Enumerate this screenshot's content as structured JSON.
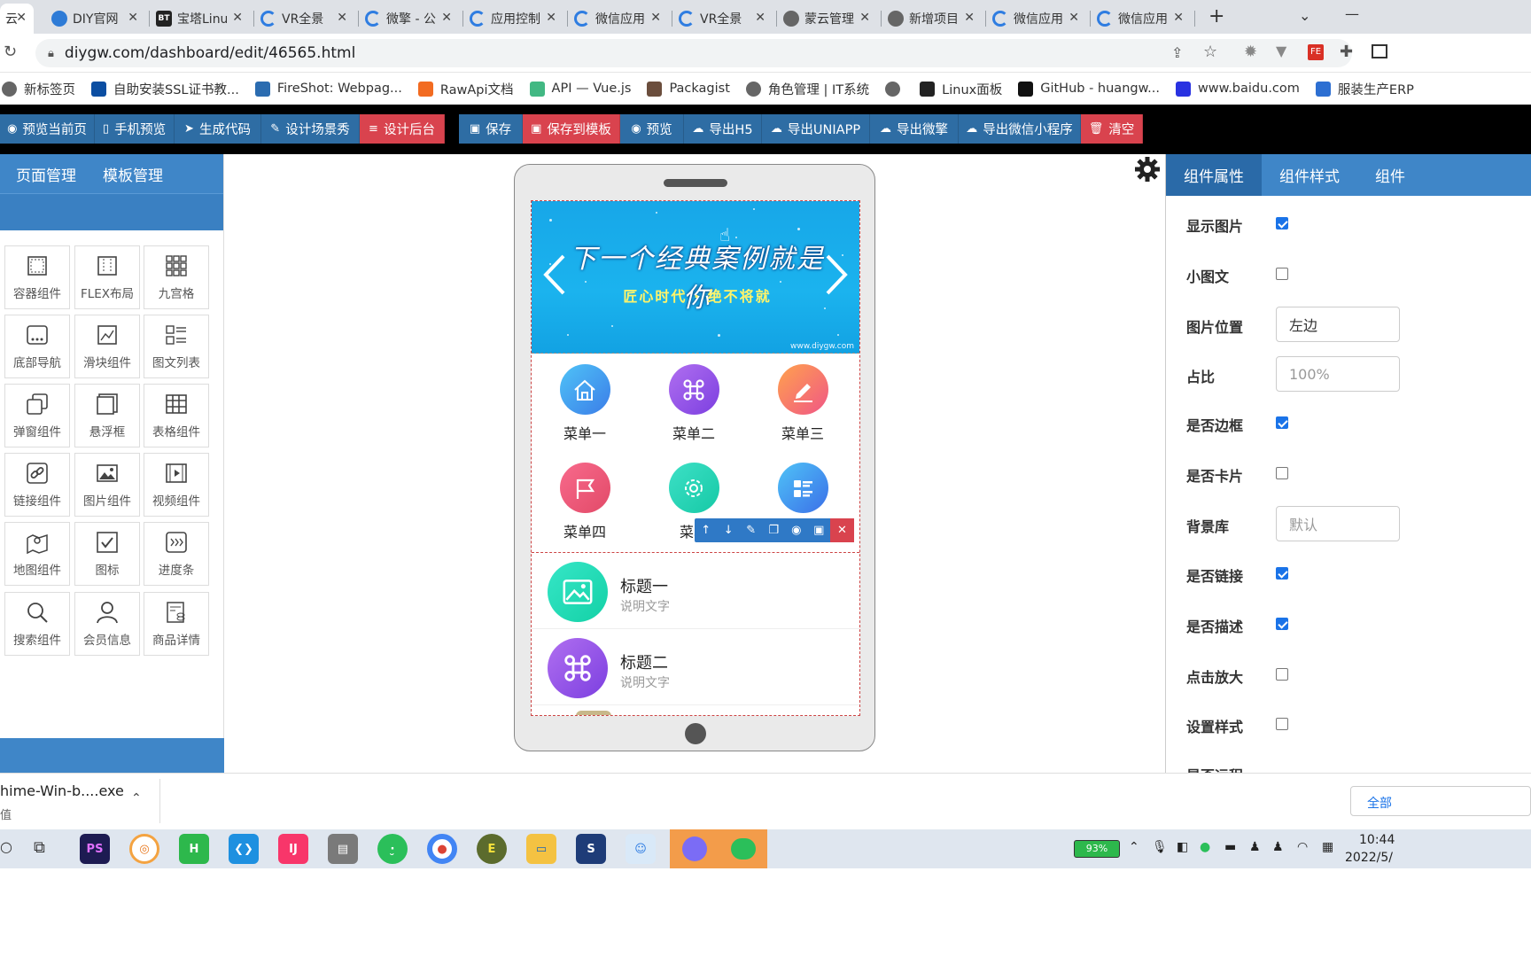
{
  "browser": {
    "tabs": [
      {
        "label": "DIY官网",
        "icon": "diy-logo-icon",
        "color": "#2e7bd6"
      },
      {
        "label": "宝塔Linux",
        "icon": "bt-icon",
        "color": "#222222"
      },
      {
        "label": "VR全景",
        "icon": "swirl-icon",
        "color": "#2f7de1"
      },
      {
        "label": "微擎 - 公",
        "icon": "swirl-icon",
        "color": "#2f7de1"
      },
      {
        "label": "应用控制",
        "icon": "swirl-icon",
        "color": "#2f7de1"
      },
      {
        "label": "微信应用",
        "icon": "swirl-icon",
        "color": "#2f7de1"
      },
      {
        "label": "VR全景",
        "icon": "swirl-icon",
        "color": "#2f7de1"
      },
      {
        "label": "蒙云管理",
        "icon": "globe-icon",
        "color": "#666666"
      },
      {
        "label": "新增项目",
        "icon": "globe-icon",
        "color": "#666666"
      },
      {
        "label": "微信应用",
        "icon": "swirl-icon",
        "color": "#2f7de1"
      },
      {
        "label": "微信应用",
        "icon": "swirl-icon",
        "color": "#2f7de1"
      }
    ],
    "url": "diygw.com/dashboard/edit/46565.html",
    "bookmarks": [
      {
        "label": "新标签页",
        "color": "#666666"
      },
      {
        "label": "自助安装SSL证书教...",
        "color": "#0b4ea2"
      },
      {
        "label": "FireShot: Webpag...",
        "color": "#2b6cb0"
      },
      {
        "label": "RawApi文档",
        "color": "#f26b21"
      },
      {
        "label": "API — Vue.js",
        "color": "#42b883"
      },
      {
        "label": "Packagist",
        "color": "#6b4e3d"
      },
      {
        "label": "角色管理 | IT系统",
        "color": "#666666"
      },
      {
        "label": "",
        "color": "#666666"
      },
      {
        "label": "Linux面板",
        "color": "#222222"
      },
      {
        "label": "GitHub - huangw...",
        "color": "#111111"
      },
      {
        "label": "www.baidu.com",
        "color": "#2932e1"
      },
      {
        "label": "服装生产ERP",
        "color": "#2d6fd2"
      }
    ]
  },
  "toolbar": {
    "group1": [
      {
        "label": "预览当前页",
        "icon": "eye-icon"
      },
      {
        "label": "手机预览",
        "icon": "mobile-icon"
      },
      {
        "label": "生成代码",
        "icon": "send-icon"
      },
      {
        "label": "设计场景秀",
        "icon": "edit-icon"
      },
      {
        "label": "设计后台",
        "icon": "database-icon"
      }
    ],
    "group2": [
      {
        "label": "保存",
        "icon": "save-icon"
      },
      {
        "label": "保存到模板",
        "icon": "save-icon"
      },
      {
        "label": "预览",
        "icon": "eye-icon"
      },
      {
        "label": "导出H5",
        "icon": "cloud-download-icon"
      },
      {
        "label": "导出UNIAPP",
        "icon": "cloud-download-icon"
      },
      {
        "label": "导出微擎",
        "icon": "cloud-download-icon"
      },
      {
        "label": "导出微信小程序",
        "icon": "cloud-download-icon"
      },
      {
        "label": "清空",
        "icon": "trash-icon"
      }
    ]
  },
  "left_panel": {
    "tabs": [
      "页面管理",
      "模板管理"
    ],
    "components": [
      {
        "label": "容器组件",
        "icon": "container-icon"
      },
      {
        "label": "FLEX布局",
        "icon": "flex-icon"
      },
      {
        "label": "九宫格",
        "icon": "grid-icon"
      },
      {
        "label": "底部导航",
        "icon": "bottom-nav-icon"
      },
      {
        "label": "滑块组件",
        "icon": "slider-icon"
      },
      {
        "label": "图文列表",
        "icon": "list-icon"
      },
      {
        "label": "弹窗组件",
        "icon": "popup-icon"
      },
      {
        "label": "悬浮框",
        "icon": "float-icon"
      },
      {
        "label": "表格组件",
        "icon": "table-icon"
      },
      {
        "label": "链接组件",
        "icon": "link-icon"
      },
      {
        "label": "图片组件",
        "icon": "image-icon"
      },
      {
        "label": "视频组件",
        "icon": "video-icon"
      },
      {
        "label": "地图组件",
        "icon": "map-icon"
      },
      {
        "label": "图标",
        "icon": "check-icon"
      },
      {
        "label": "进度条",
        "icon": "progress-icon"
      },
      {
        "label": "搜索组件",
        "icon": "search-icon"
      },
      {
        "label": "会员信息",
        "icon": "user-icon"
      },
      {
        "label": "商品详情",
        "icon": "goods-icon"
      }
    ]
  },
  "phone": {
    "banner": {
      "title": "下一个经典案例就是你",
      "subtitle": "匠心时代 · 绝不将就",
      "watermark": "www.diygw.com"
    },
    "menus": [
      {
        "label": "菜单一",
        "icon": "home-icon",
        "color_from": "#4fc3f7",
        "color_to": "#3b7de8"
      },
      {
        "label": "菜单二",
        "icon": "command-icon",
        "color_from": "#b06ff0",
        "color_to": "#7c3fe0"
      },
      {
        "label": "菜单三",
        "icon": "pencil-icon",
        "color_from": "#ffa24d",
        "color_to": "#f05686"
      },
      {
        "label": "菜单四",
        "icon": "flag-icon",
        "color_from": "#f86a8c",
        "color_to": "#e24a68"
      },
      {
        "label": "菜单",
        "icon": "settings-icon",
        "color_from": "#3de0c6",
        "color_to": "#16c9a6"
      },
      {
        "label": "",
        "icon": "list-icon",
        "color_from": "#4fc3f7",
        "color_to": "#3b6fe8"
      }
    ],
    "list": [
      {
        "title": "标题一",
        "desc": "说明文字",
        "icon": "image-icon",
        "color_from": "#36e6c7",
        "color_to": "#13d1a6"
      },
      {
        "title": "标题二",
        "desc": "说明文字",
        "icon": "command-icon",
        "color_from": "#b06ff0",
        "color_to": "#7c3fe0"
      }
    ]
  },
  "right_panel": {
    "tabs": [
      "组件属性",
      "组件样式",
      "组件"
    ],
    "properties": [
      {
        "label": "显示图片",
        "type": "checkbox",
        "checked": true
      },
      {
        "label": "小图文",
        "type": "checkbox",
        "checked": false
      },
      {
        "label": "图片位置",
        "type": "select",
        "value": "左边"
      },
      {
        "label": "占比",
        "type": "input",
        "placeholder": "100%"
      },
      {
        "label": "是否边框",
        "type": "checkbox",
        "checked": true
      },
      {
        "label": "是否卡片",
        "type": "checkbox",
        "checked": false
      },
      {
        "label": "背景库",
        "type": "input",
        "placeholder": "默认"
      },
      {
        "label": "是否链接",
        "type": "checkbox",
        "checked": true
      },
      {
        "label": "是否描述",
        "type": "checkbox",
        "checked": true
      },
      {
        "label": "点击放大",
        "type": "checkbox",
        "checked": false
      },
      {
        "label": "设置样式",
        "type": "checkbox",
        "checked": false
      }
    ]
  },
  "download": {
    "filename": "hime-Win-b....exe",
    "show_all": "全部"
  },
  "taskbar": {
    "battery": "93%",
    "time": "10:44",
    "date": "2022/5/"
  }
}
